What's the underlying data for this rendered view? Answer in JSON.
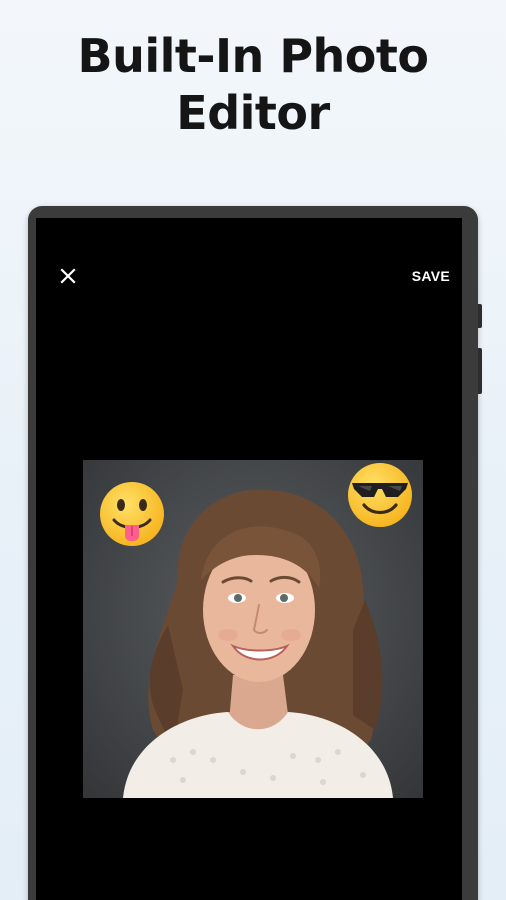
{
  "headline": {
    "line1": "Built-In Photo",
    "line2": "Editor"
  },
  "editor": {
    "close_icon": "close-icon",
    "save_label": "SAVE",
    "photo": "portrait-photo",
    "stickers": [
      {
        "name": "face-with-tongue-emoji"
      },
      {
        "name": "smiling-face-with-sunglasses-emoji"
      }
    ]
  },
  "colors": {
    "background_top": "#f3f7fb",
    "background_bottom": "#e4eef7",
    "device_frame": "#3b3b3b",
    "screen": "#000000",
    "headline_text": "#151515",
    "emoji_yellow": "#ffcb2e"
  }
}
